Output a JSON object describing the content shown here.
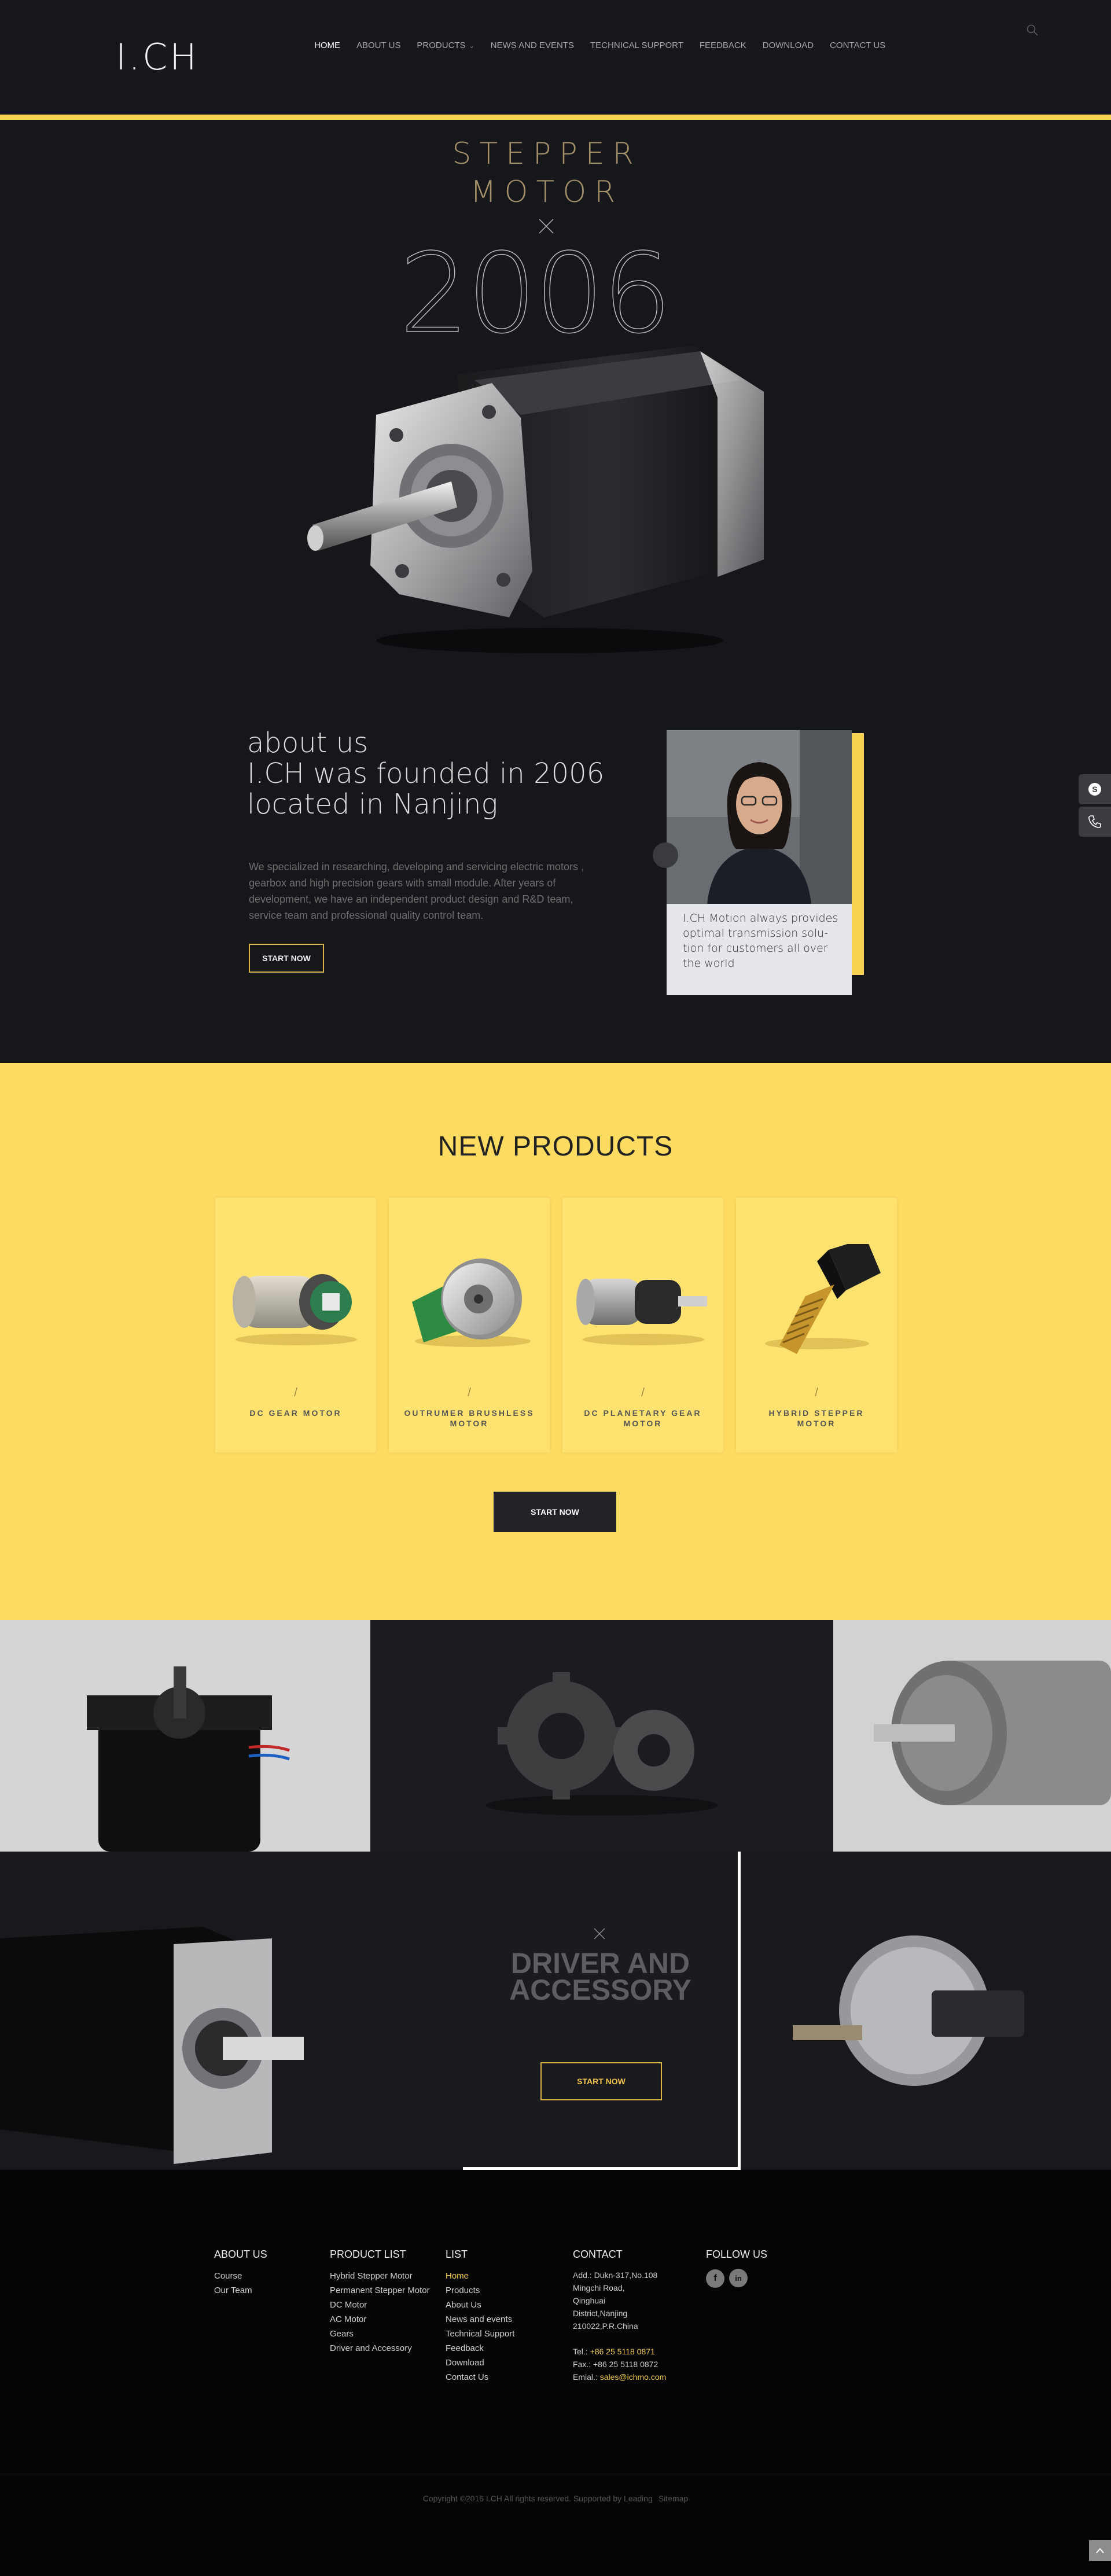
{
  "header": {
    "logo": "I.CH",
    "nav": [
      {
        "label": "HOME",
        "active": true
      },
      {
        "label": "ABOUT US"
      },
      {
        "label": "PRODUCTS",
        "has_caret": true
      },
      {
        "label": "NEWS AND EVENTS"
      },
      {
        "label": "TECHNICAL SUPPORT"
      },
      {
        "label": "FEEDBACK"
      },
      {
        "label": "DOWNLOAD"
      },
      {
        "label": "CONTACT US"
      }
    ],
    "search_icon": "search-icon",
    "accent_color": "#f7d150"
  },
  "hero": {
    "title_line1": "STEPPER",
    "title_line2": "MOTOR",
    "year": "2006"
  },
  "about": {
    "heading_line1": "about us",
    "heading_line2": "I.CH  was founded in 2006",
    "heading_line3": "located in Nanjing",
    "text": "We specialized in researching, developing and servicing electric motors , gearbox and high precision gears with small module. After years of development, we have an independent product  design and R&D team, service team and professional quality control team.",
    "button": "START NOW",
    "caption": "I.CH Motion always provides optimal transmission solu- tion for customers all over the world"
  },
  "side_buttons": [
    "skype-icon",
    "phone-icon"
  ],
  "products": {
    "title": "NEW PRODUCTS",
    "items": [
      {
        "name": "DC GEAR MOTOR"
      },
      {
        "name": "OUTRUMER BRUSHLESS MOTOR"
      },
      {
        "name": "DC PLANETARY GEAR MOTOR"
      },
      {
        "name": "HYBRID STEPPER MOTOR"
      }
    ],
    "slash": "/",
    "button": "START NOW",
    "background": "#fedc62"
  },
  "gallery": {
    "driver_title": "DRIVER AND ACCESSORY",
    "driver_button": "START NOW"
  },
  "footer": {
    "about": {
      "heading": "ABOUT US",
      "links": [
        "Course",
        "Our Team"
      ]
    },
    "product_list": {
      "heading": "PRODUCT LIST",
      "links": [
        "Hybrid Stepper Motor",
        "Permanent Stepper Motor",
        "DC Motor",
        "AC Motor",
        "Gears",
        "Driver and Accessory"
      ]
    },
    "list": {
      "heading": "LIST",
      "links": [
        "Home",
        "Products",
        "About Us",
        "News and events",
        "Technical Support",
        "Feedback",
        "Download",
        "Contact Us"
      ]
    },
    "contact": {
      "heading": "CONTACT",
      "address_lines": [
        "Add.: Dukn-317,No.108",
        "Mingchi Road,",
        "Qinghuai",
        "District,Nanjing",
        "210022,P.R.China"
      ],
      "tel_label": "Tel.: ",
      "tel": "+86 25 5118 0871",
      "fax": "Fax.: +86 25 5118 0872",
      "email_label": "Emial.: ",
      "email": "sales@ichmo.com"
    },
    "follow": {
      "heading": "FOLLOW US",
      "icons": [
        "facebook-icon",
        "linkedin-icon"
      ],
      "facebook_glyph": "f",
      "linkedin_glyph": "in"
    },
    "copyright": "Copyright  ©2016 I.CH All rights reserved. Supported by Leading",
    "sitemap": "Sitemap"
  }
}
